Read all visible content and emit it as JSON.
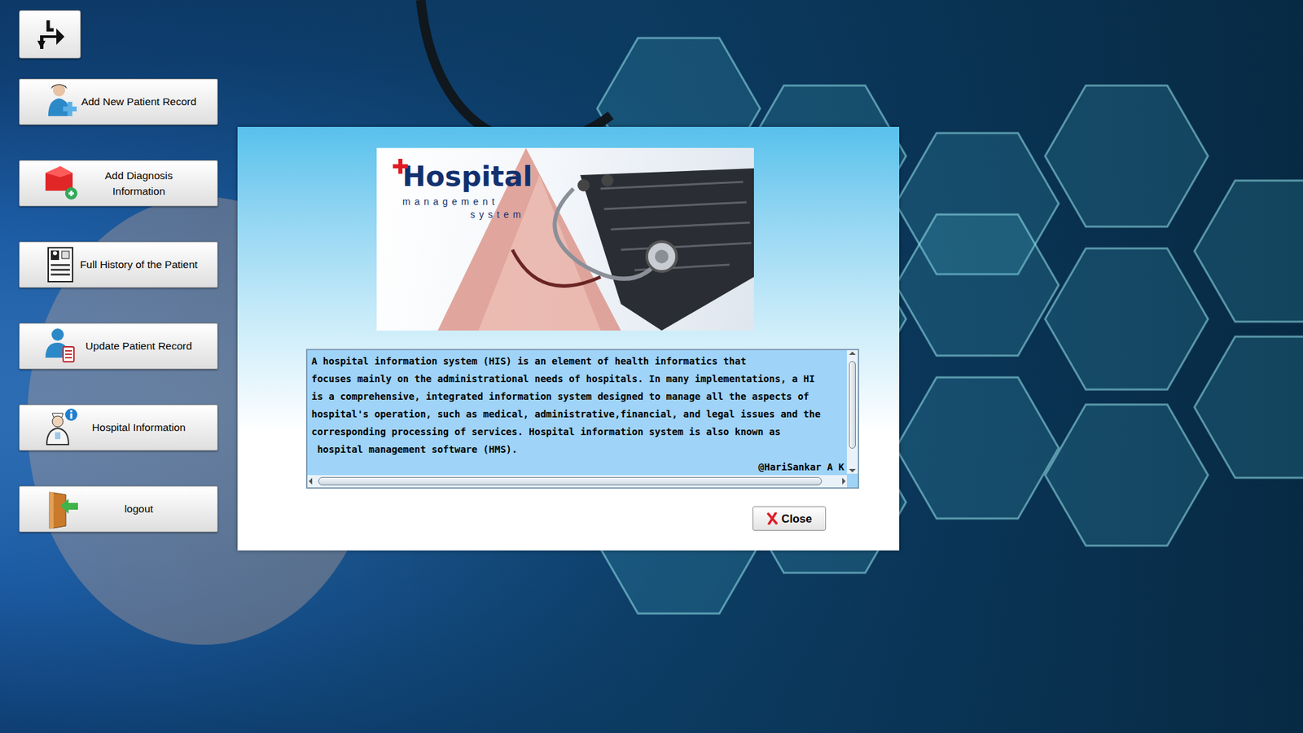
{
  "sidebar": {
    "items": [
      {
        "label": "Add New Patient Record"
      },
      {
        "label": "Add Diagnosis Information"
      },
      {
        "label": "Full History of the Patient"
      },
      {
        "label": "Update Patient Record"
      },
      {
        "label": "Hospital Information"
      },
      {
        "label": "logout"
      }
    ]
  },
  "dialog": {
    "banner": {
      "logo": "Hospital",
      "tagline_1": "management",
      "tagline_2": "system"
    },
    "text_lines": [
      "A hospital information system (HIS) is an element of health informatics that",
      "focuses mainly on the administrational needs of hospitals. In many implementations, a HI",
      "is a comprehensive, integrated information system designed to manage all the aspects of",
      "hospital's operation, such as medical, administrative,financial, and legal issues and the",
      "corresponding processing of services. Hospital information system is also known as",
      " hospital management software (HMS)."
    ],
    "signature": "@HariSankar A K",
    "scrollbars": {
      "vertical": {
        "level": 0.86
      },
      "horizontal": {
        "level": 0.97
      }
    },
    "buttons": [
      {
        "label": "Close"
      }
    ]
  }
}
